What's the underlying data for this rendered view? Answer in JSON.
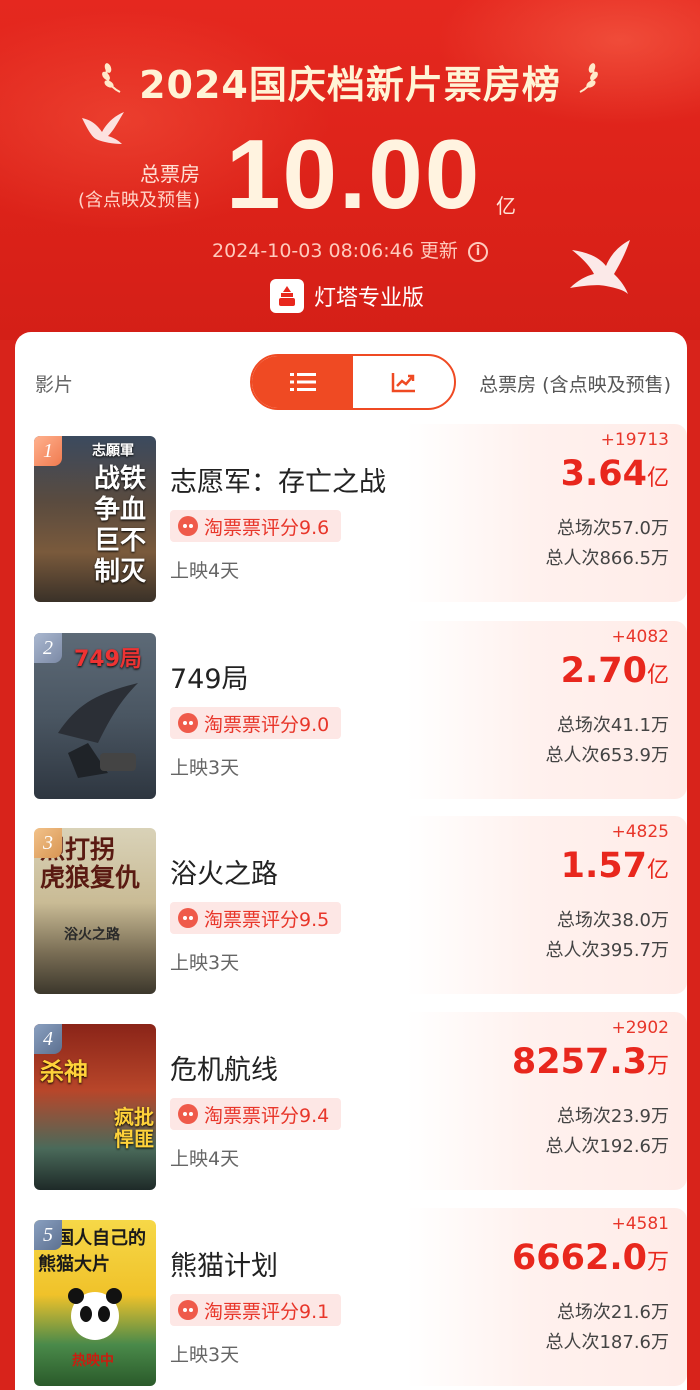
{
  "header": {
    "title": "2024国庆档新片票房榜",
    "total_label": "总票房",
    "total_sublabel": "(含点映及预售)",
    "total_value": "10.00",
    "total_unit": "亿",
    "update_time": "2024-10-03 08:06:46 更新",
    "brand": "灯塔专业版"
  },
  "list_header": {
    "film_col": "影片",
    "box_col": "总票房 (含点映及预售)"
  },
  "colors": {
    "accent": "#ef4a23",
    "price_red": "#e8271d",
    "bg_red": "#d8231b"
  },
  "films": [
    {
      "rank": "1",
      "title": "志愿军：存亡之战",
      "rating": "淘票票评分9.6",
      "days": "上映4天",
      "delta": "+19713",
      "gross": "3.64",
      "gross_unit": "亿",
      "shows": "总场次57.0万",
      "viewers": "总人次866.5万",
      "poster_text_top": "志願軍",
      "poster_text_main": "战铁\n争血\n巨不\n制灭"
    },
    {
      "rank": "2",
      "title": "749局",
      "rating": "淘票票评分9.0",
      "days": "上映3天",
      "delta": "+4082",
      "gross": "2.70",
      "gross_unit": "亿",
      "shows": "总场次41.1万",
      "viewers": "总人次653.9万",
      "poster_text_top": "749局",
      "poster_text_main": ""
    },
    {
      "rank": "3",
      "title": "浴火之路",
      "rating": "淘票票评分9.5",
      "days": "上映3天",
      "delta": "+4825",
      "gross": "1.57",
      "gross_unit": "亿",
      "shows": "总场次38.0万",
      "viewers": "总人次395.7万",
      "poster_text_top": "烈打拐\n虎狼复仇",
      "poster_text_main": "浴火之路"
    },
    {
      "rank": "4",
      "title": "危机航线",
      "rating": "淘票票评分9.4",
      "days": "上映4天",
      "delta": "+2902",
      "gross": "8257.3",
      "gross_unit": "万",
      "shows": "总场次23.9万",
      "viewers": "总人次192.6万",
      "poster_text_top": "杀神",
      "poster_text_main": "疯批\n悍匪"
    },
    {
      "rank": "5",
      "title": "熊猫计划",
      "rating": "淘票票评分9.1",
      "days": "上映3天",
      "delta": "+4581",
      "gross": "6662.0",
      "gross_unit": "万",
      "shows": "总场次21.6万",
      "viewers": "总人次187.6万",
      "poster_text_top": "中国人自己的\n熊猫大片",
      "poster_text_main": "热映中"
    }
  ]
}
